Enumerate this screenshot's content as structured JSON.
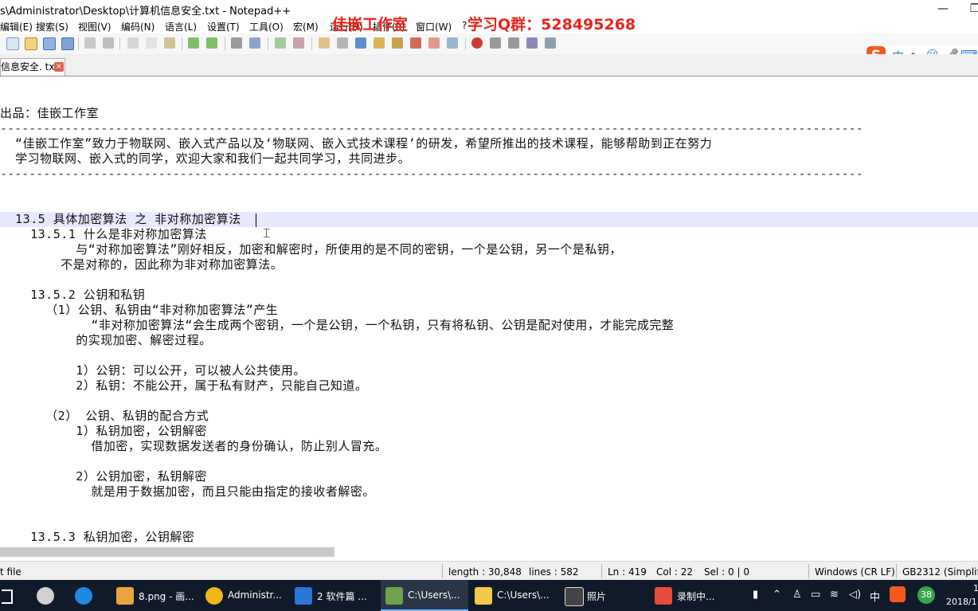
{
  "window": {
    "title": "s\\Administrator\\Desktop\\计算机信息安全.txt - Notepad++",
    "minimize": "—",
    "restore": "❐"
  },
  "menu": [
    "编辑(E)",
    "搜索(S)",
    "视图(V)",
    "编码(N)",
    "语言(L)",
    "设置(T)",
    "工具(O)",
    "宏(M)",
    "运行(R)",
    "插件(P)",
    "窗口(W)",
    "?"
  ],
  "overlay": {
    "studio": "佳嵌工作室",
    "qq": "学习Q群：528495268"
  },
  "ime": {
    "logo": "S",
    "lang": "中",
    "punct": "•,",
    "emoji": "☺",
    "mic": "🎤",
    "keyboard": "⌨"
  },
  "tab": {
    "label": "信息安全. txt",
    "close": "×"
  },
  "editor_lines": [
    "出品：佳嵌工作室",
    "------------------------------------------------------------------------------------------------------------------------",
    "  “佳嵌工作室”致力于物联网、嵌入式产品以及‘物联网、嵌入式技术课程’的研发，希望所推出的技术课程，能够帮助到正在努力",
    "  学习物联网、嵌入式的同学，欢迎大家和我们一起共同学习，共同进步。",
    "------------------------------------------------------------------------------------------------------------------------",
    "",
    "",
    "  13.5 具体加密算法 之 非对称加密算法",
    "    13.5.1 什么是非对称加密算法",
    "          与“对称加密算法”刚好相反，加密和解密时，所使用的是不同的密钥，一个是公钥，另一个是私钥，",
    "        不是对称的，因此称为非对称加密算法。",
    "",
    "    13.5.2 公钥和私钥",
    "      （1）公钥、私钥由“非对称加密算法”产生",
    "            “非对称加密算法“会生成两个密钥，一个是公钥，一个私钥，只有将私钥、公钥是配对使用，才能完成完整",
    "          的实现加密、解密过程。",
    "",
    "          1）公钥：可以公开，可以被人公共使用。",
    "          2）私钥：不能公开，属于私有财产，只能自己知道。",
    "",
    "      （2） 公钥、私钥的配合方式",
    "          1）私钥加密，公钥解密",
    "            借加密，实现数据发送者的身份确认，防止别人冒充。",
    "",
    "          2）公钥加密，私钥解密",
    "            就是用于数据加密，而且只能由指定的接收者解密。",
    "",
    "",
    "    13.5.3 私钥加密，公钥解密"
  ],
  "status": {
    "file_type": "t file",
    "length": "length : 30,848",
    "lines": "lines : 582",
    "ln": "Ln : 419",
    "col": "Col : 22",
    "sel": "Sel : 0 | 0",
    "eol": "Windows (CR LF)",
    "encoding": "GB2312 (Simplifi"
  },
  "taskbar": {
    "items": [
      {
        "label": "8.png - 画...",
        "color": "#e8a33a"
      },
      {
        "label": "Administr...",
        "color": "#f2b51c"
      },
      {
        "label": "2 软件篇 ...",
        "color": "#2b76d6"
      },
      {
        "label": "C:\\Users\\...",
        "color": "#6da34d"
      },
      {
        "label": "C:\\Users\\...",
        "color": "#f2c94c"
      },
      {
        "label": "照片",
        "color": "#444444"
      },
      {
        "label": "录制中...",
        "color": "#e84a3c"
      }
    ],
    "tray_ime": "中",
    "badge": "38",
    "time": "1",
    "date": "2018/1"
  }
}
